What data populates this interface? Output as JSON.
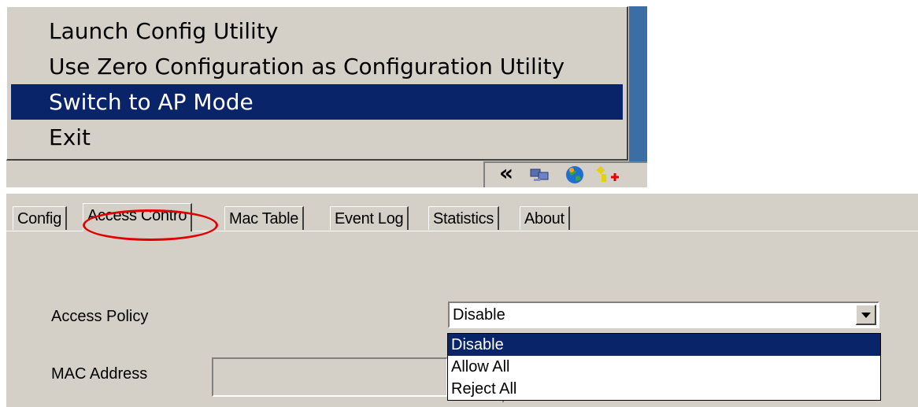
{
  "context_menu": {
    "items": [
      {
        "label": "Launch Config Utility",
        "selected": false
      },
      {
        "label": "Use Zero Configuration as Configuration Utility",
        "selected": false
      },
      {
        "label": "Switch to AP Mode",
        "selected": true
      },
      {
        "label": "Exit",
        "selected": false
      }
    ]
  },
  "tray": {
    "chevron": "«",
    "icons": [
      "network-computers-icon",
      "globe-icon",
      "wireless-ap-icon"
    ]
  },
  "tabs": [
    {
      "label": "Config",
      "active": false
    },
    {
      "label": "Access Contro",
      "active": true
    },
    {
      "label": "Mac Table",
      "active": false
    },
    {
      "label": "Event Log",
      "active": false
    },
    {
      "label": "Statistics",
      "active": false
    },
    {
      "label": "About",
      "active": false
    }
  ],
  "form": {
    "access_policy_label": "Access Policy",
    "access_policy_value": "Disable",
    "access_policy_options": [
      "Disable",
      "Allow All",
      "Reject All"
    ],
    "mac_address_label": "MAC Address"
  },
  "colors": {
    "menu_highlight": "#0a246a",
    "annotation": "#e00000",
    "desktop": "#3a6ea5"
  }
}
